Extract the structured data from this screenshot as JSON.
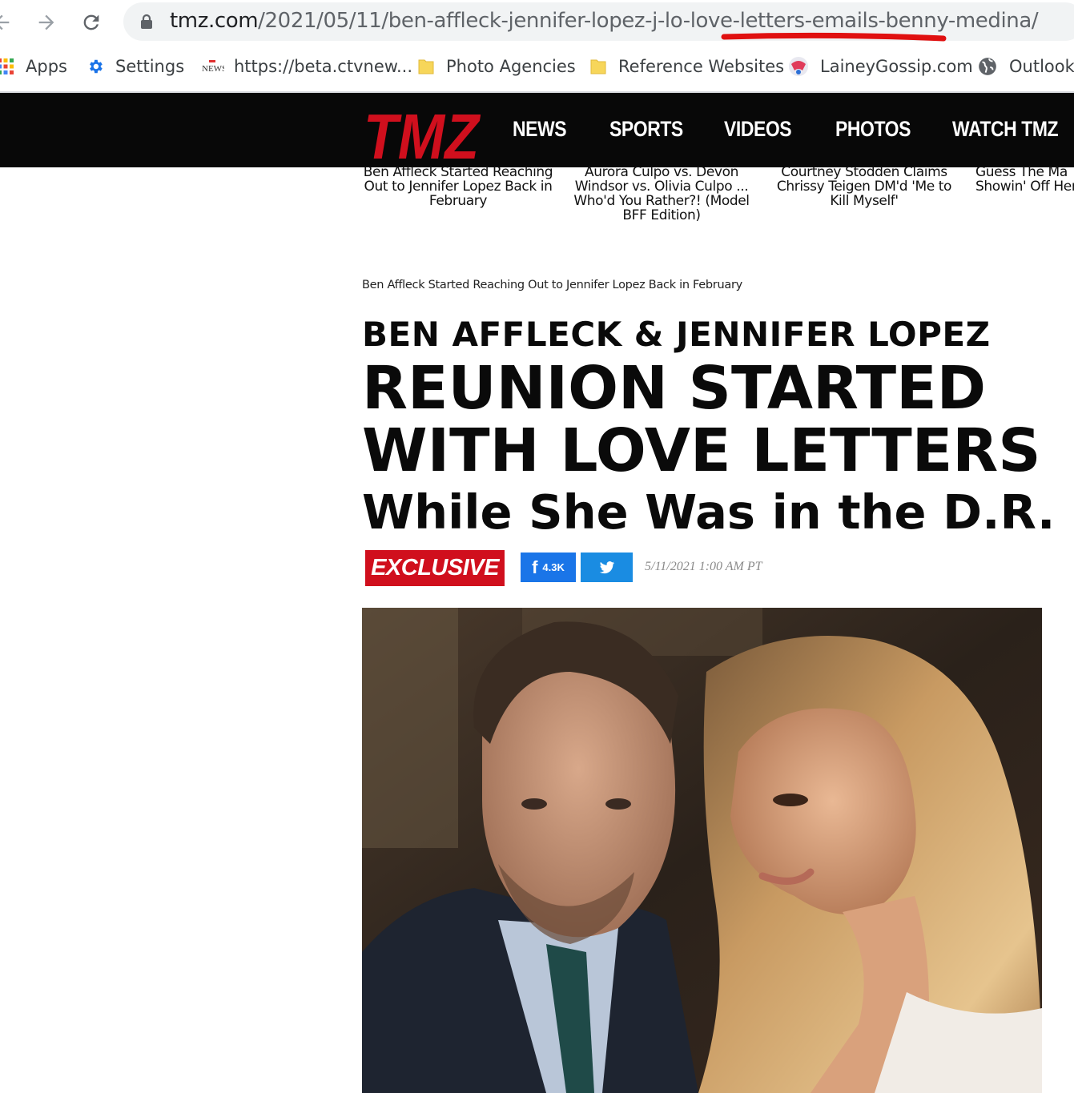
{
  "browser": {
    "url_host": "tmz.com",
    "url_path": "/2021/05/11/ben-affleck-jennifer-lopez-j-lo-love-letters-emails-benny-medina/",
    "annotation_color": "#e01010",
    "bookmarks": [
      {
        "label": "Apps",
        "icon": "apps-grid-icon"
      },
      {
        "label": "Settings",
        "icon": "gear-icon"
      },
      {
        "label": "https://beta.ctvnew...",
        "icon": "ctv-news-icon"
      },
      {
        "label": "Photo Agencies",
        "icon": "folder-icon"
      },
      {
        "label": "Reference Websites",
        "icon": "folder-icon"
      },
      {
        "label": "LaineyGossip.com",
        "icon": "laineygossip-icon"
      },
      {
        "label": "Outlook",
        "icon": "globe-icon"
      }
    ]
  },
  "tmz": {
    "logo_text": "TMZ",
    "brand_color": "#d00f1d",
    "nav": [
      "NEWS",
      "SPORTS",
      "VIDEOS",
      "PHOTOS",
      "WATCH TMZ"
    ],
    "related": [
      "Ben Affleck Started Reaching Out to Jennifer Lopez Back in February",
      "Aurora Culpo vs. Devon Windsor vs. Olivia Culpo ... Who'd You Rather?! (Model BFF Edition)",
      "Courtney Stodden Claims Chrissy Teigen DM'd 'Me to Kill Myself'",
      "Guess The Ma Showin' Off Her"
    ]
  },
  "article": {
    "breadcrumb": "Ben Affleck Started Reaching Out to Jennifer Lopez Back in February",
    "headline_1": "BEN AFFLECK & JENNIFER LOPEZ",
    "headline_2": "REUNION STARTED",
    "headline_3": "WITH LOVE LETTERS",
    "headline_4": "While She Was in the D.R.",
    "badge": "EXCLUSIVE",
    "facebook_count": "4.3K",
    "date": "5/11/2021 1:00 AM PT"
  }
}
